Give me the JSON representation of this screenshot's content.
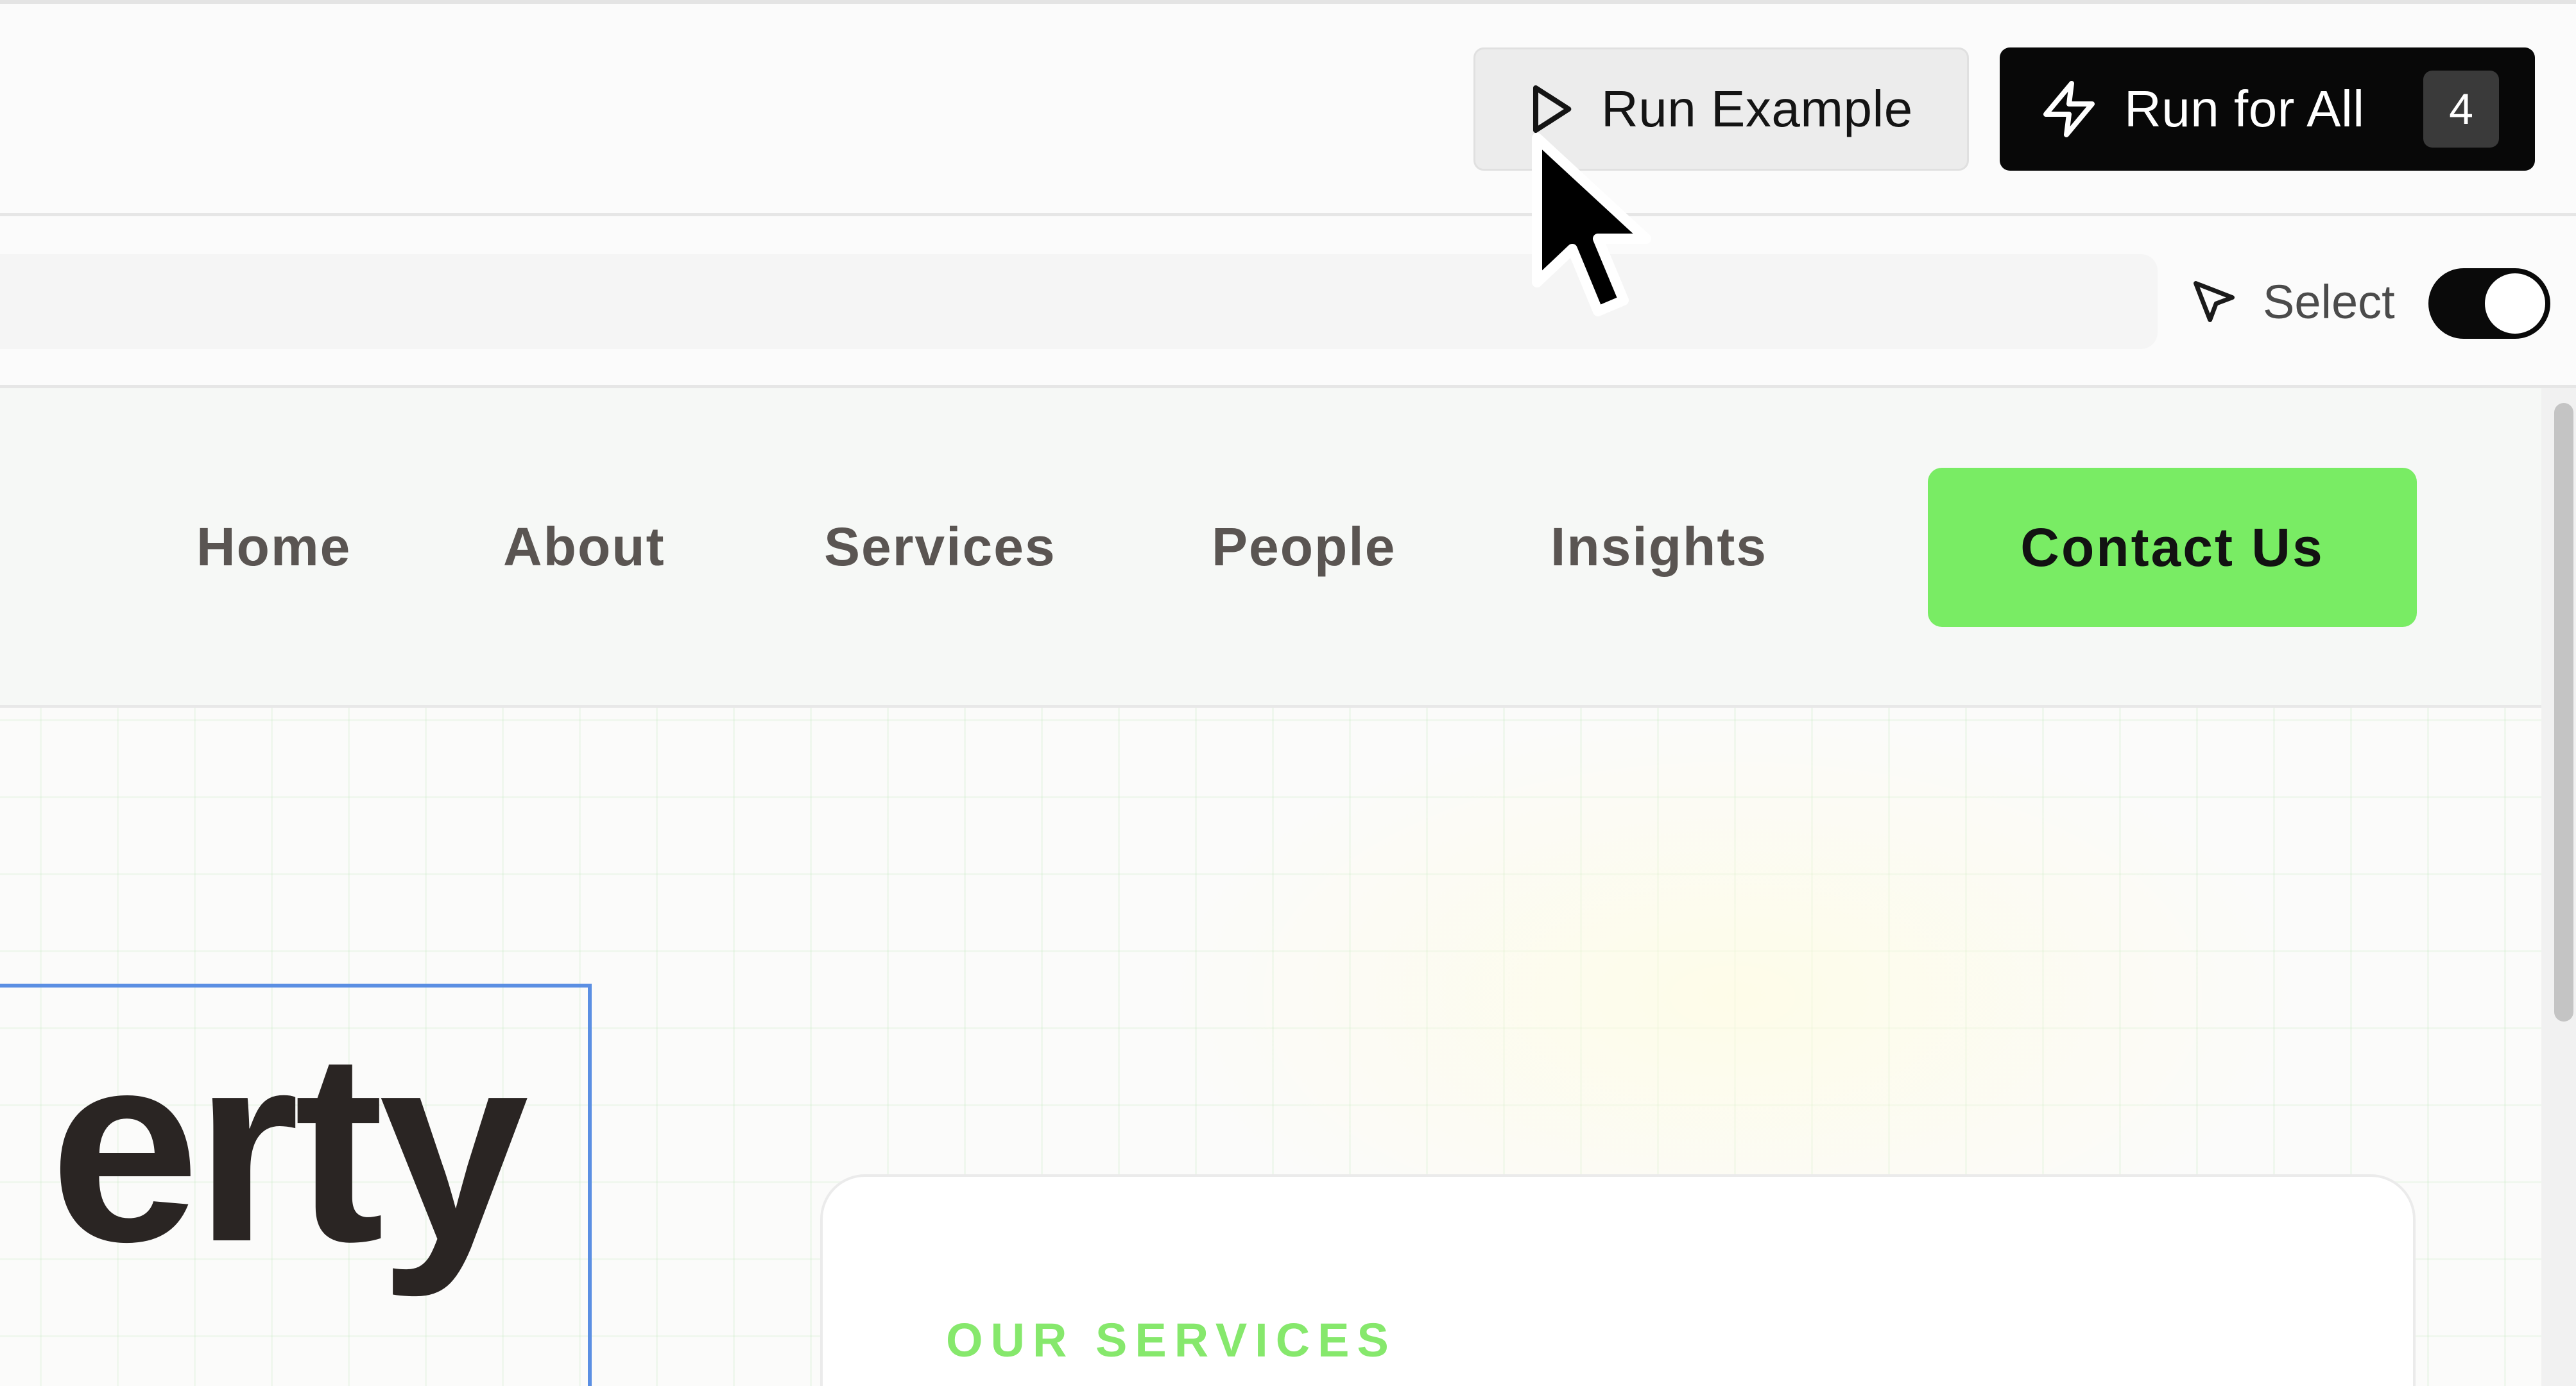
{
  "toolbar": {
    "run_example_label": "Run Example",
    "run_all_label": "Run for All",
    "run_all_count": "4"
  },
  "selection": {
    "select_label": "Select",
    "toggle_on": true
  },
  "site": {
    "nav": {
      "links": [
        "Home",
        "About",
        "Services",
        "People",
        "Insights"
      ],
      "cta_label": "Contact Us"
    },
    "hero": {
      "headline_visible": "erty",
      "services_label": "OUR SERVICES"
    }
  },
  "icons": {
    "run_example": "play-icon",
    "run_all": "lightning-icon",
    "select": "pointer-icon"
  },
  "colors": {
    "accent_green": "#79ec64",
    "services_label_green": "#86e86c",
    "selection_outline": "#5b8fe3",
    "run_all_bg": "#080808"
  }
}
